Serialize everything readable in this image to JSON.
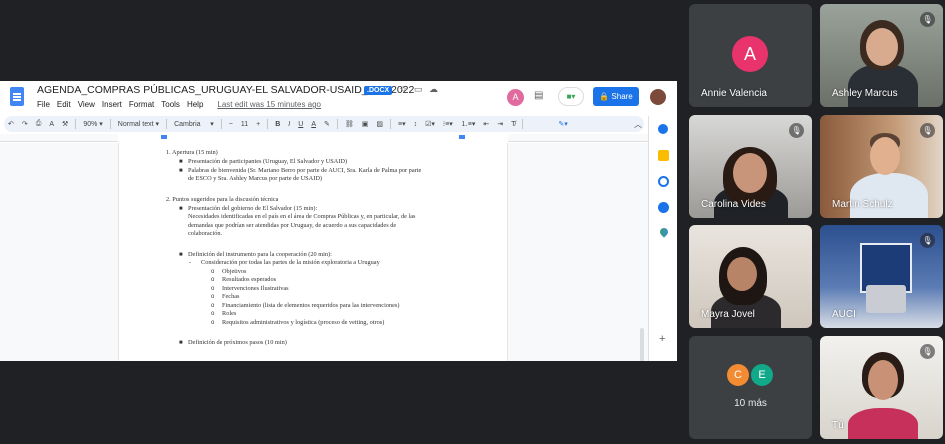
{
  "doc": {
    "title": "AGENDA_COMPRAS PÚBLICAS_URUGUAY-EL SALVADOR-USAID_15.7.2022",
    "badge": ".DOCX",
    "menus": [
      "File",
      "Edit",
      "View",
      "Insert",
      "Format",
      "Tools",
      "Help"
    ],
    "last_edit": "Last edit was 15 minutes ago",
    "user_initial": "A",
    "share_label": "Share",
    "toolbar": {
      "zoom": "90%",
      "style": "Normal text",
      "font": "Cambria",
      "font_size": "11"
    },
    "content": [
      {
        "text": "1. Apertura (15 min)"
      },
      {
        "text": "Presentación de participantes (Uruguay, El Salvador y USAID)"
      },
      {
        "text": "Palabras de bienvenida (Sr. Mariano Berro por parte de AUCI, Sra. Karla de Palma por parte"
      },
      {
        "text": "de ESCO y Sra. Ashley Marcus por parte de USAID)"
      },
      {
        "text": "2. Puntos sugeridos para la discusión técnica"
      },
      {
        "text": "Presentación del gobierno de El Salvador (15 min):"
      },
      {
        "text": "Necesidades identificadas en el país en el área de Compras Públicas y, en particular, de las"
      },
      {
        "text": "demandas que podrían ser atendidas por Uruguay, de acuerdo a sus capacidades de"
      },
      {
        "text": "colaboración."
      },
      {
        "text": "Definición del instrumento para la cooperación (20 min):"
      },
      {
        "text": "Consideración por todas las partes de la misión exploratoria a Uruguay"
      },
      {
        "text": "Objetivos"
      },
      {
        "text": "Resultados esperados"
      },
      {
        "text": "Intervenciones Ilustrativas"
      },
      {
        "text": "Fechas"
      },
      {
        "text": "Financiamiento (lista de elementos requeridos para las intervenciones)"
      },
      {
        "text": "Roles"
      },
      {
        "text": "Requisitos administrativos y logística (proceso de vetting, otros)"
      },
      {
        "text": "Definición de próximos pasos (10 min)"
      }
    ]
  },
  "participants": [
    {
      "name": "Annie Valencia",
      "initial": "A",
      "avatar_color": "#e8336d"
    },
    {
      "name": "Ashley Marcus"
    },
    {
      "name": "Carolina Vides"
    },
    {
      "name": "Martin Schulz"
    },
    {
      "name": "Mayra Jovel"
    },
    {
      "name": "AUCI"
    },
    {
      "name": "Tú"
    }
  ],
  "more": {
    "initials": [
      "C",
      "E"
    ],
    "colors": [
      "#f28b32",
      "#12a88a"
    ],
    "label": "10 más"
  }
}
